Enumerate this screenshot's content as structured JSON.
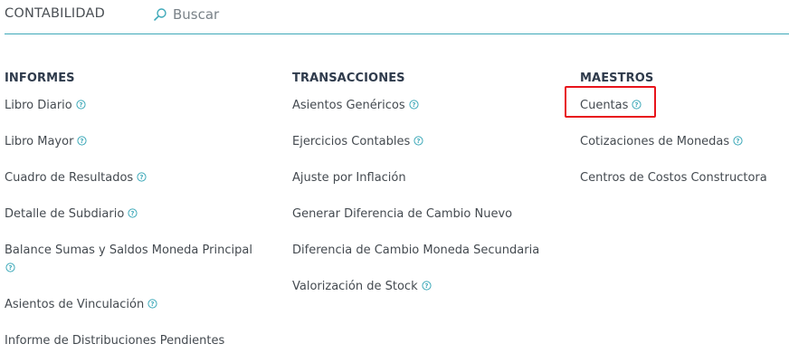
{
  "header": {
    "title": "CONTABILIDAD",
    "search": {
      "placeholder": "Buscar",
      "value": ""
    }
  },
  "columns": [
    {
      "title": "INFORMES",
      "items": [
        {
          "label": "Libro Diario",
          "help": true
        },
        {
          "label": "Libro Mayor",
          "help": true
        },
        {
          "label": "Cuadro de Resultados",
          "help": true
        },
        {
          "label": "Detalle de Subdiario",
          "help": true
        },
        {
          "label": "Balance Sumas y Saldos Moneda Principal",
          "help": true
        },
        {
          "label": "Asientos de Vinculación",
          "help": true
        },
        {
          "label": "Informe de Distribuciones Pendientes",
          "help": false
        }
      ]
    },
    {
      "title": "TRANSACCIONES",
      "items": [
        {
          "label": "Asientos Genéricos",
          "help": true
        },
        {
          "label": "Ejercicios Contables",
          "help": true
        },
        {
          "label": "Ajuste por Inflación",
          "help": false
        },
        {
          "label": "Generar Diferencia de Cambio Nuevo",
          "help": false
        },
        {
          "label": "Diferencia de Cambio Moneda Secundaria",
          "help": false
        },
        {
          "label": "Valorización de Stock",
          "help": true
        }
      ]
    },
    {
      "title": "MAESTROS",
      "items": [
        {
          "label": "Cuentas",
          "help": true,
          "highlighted": true
        },
        {
          "label": "Cotizaciones de Monedas",
          "help": true
        },
        {
          "label": "Centros de Costos Constructora",
          "help": false
        }
      ]
    }
  ],
  "colors": {
    "accent": "#3ea9b9",
    "heading": "#2f3b4c",
    "text": "#444a50",
    "highlight": "#e8141b"
  },
  "icons": {
    "search": "search-icon",
    "help": "help-icon"
  }
}
